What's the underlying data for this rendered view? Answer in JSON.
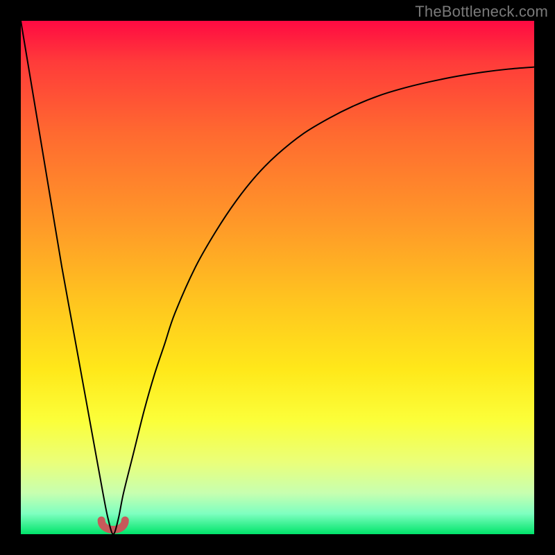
{
  "watermark": "TheBottleneck.com",
  "chart_data": {
    "type": "line",
    "title": "",
    "xlabel": "",
    "ylabel": "",
    "xlim": [
      0,
      100
    ],
    "ylim": [
      0,
      100
    ],
    "grid": false,
    "legend": false,
    "notch_x": 18,
    "notch_width": 3,
    "notch_color": "#c65a5a",
    "curve_color": "#000000",
    "curve_stroke": 2,
    "x": [
      0,
      2,
      4,
      6,
      8,
      10,
      12,
      14,
      16,
      17,
      18,
      19,
      20,
      22,
      24,
      26,
      28,
      30,
      34,
      38,
      42,
      46,
      50,
      55,
      60,
      65,
      70,
      75,
      80,
      85,
      90,
      95,
      100
    ],
    "y": [
      100,
      88,
      76,
      64,
      52,
      41,
      30,
      19,
      8,
      3,
      0,
      3,
      8,
      16,
      24,
      31,
      37,
      43,
      52,
      59,
      65,
      70,
      74,
      78,
      81,
      83.5,
      85.5,
      87,
      88.2,
      89.2,
      90,
      90.6,
      91
    ]
  },
  "gradient_colors": {
    "top": "#ff0a42",
    "mid_high": "#ff9a28",
    "mid": "#ffe81a",
    "mid_low": "#eaff7a",
    "bottom": "#00e46a"
  }
}
